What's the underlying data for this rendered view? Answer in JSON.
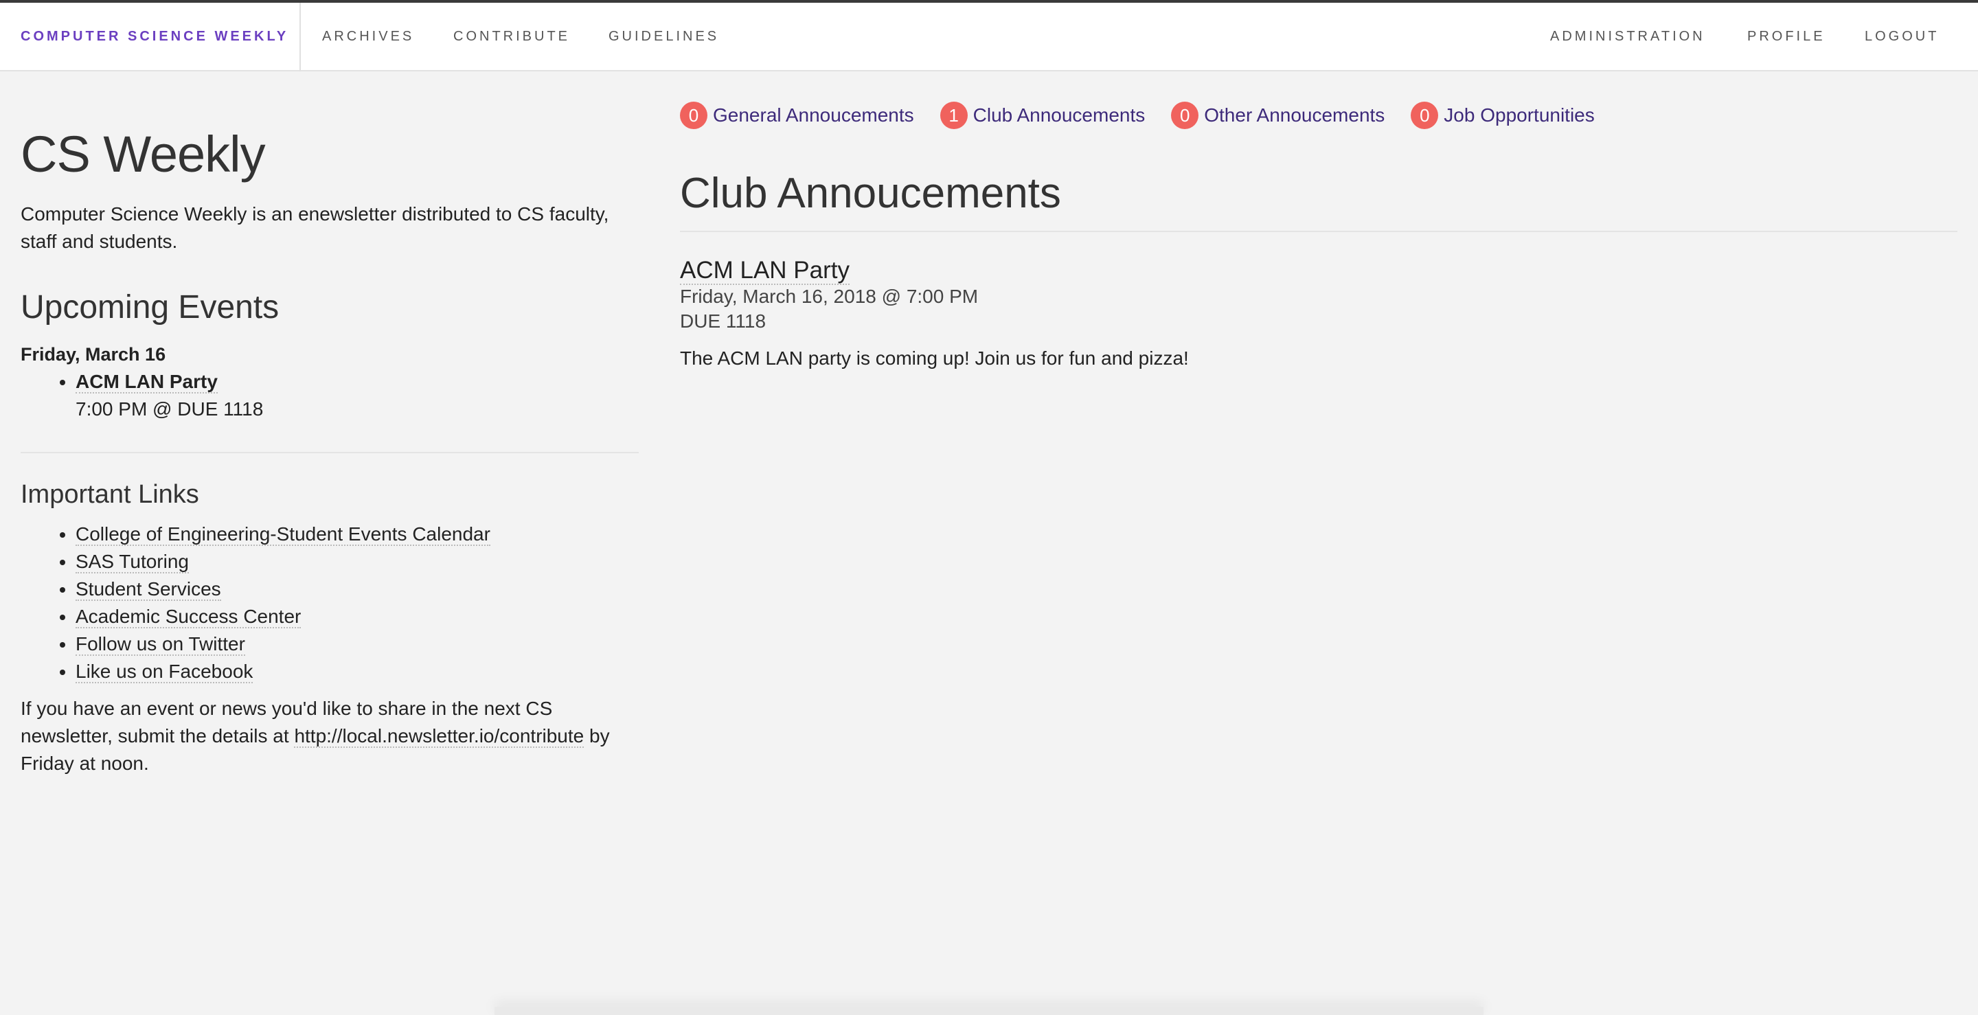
{
  "header": {
    "brand": "COMPUTER SCIENCE WEEKLY",
    "nav_left": [
      "ARCHIVES",
      "CONTRIBUTE",
      "GUIDELINES"
    ],
    "nav_right": [
      "ADMINISTRATION",
      "PROFILE",
      "LOGOUT"
    ]
  },
  "sidebar": {
    "title": "CS Weekly",
    "intro": "Computer Science Weekly is an enewsletter distributed to CS faculty, staff and students.",
    "upcoming_title": "Upcoming Events",
    "event_day": "Friday, March 16",
    "events": [
      {
        "title": "ACM LAN Party",
        "detail": "7:00 PM @ DUE 1118"
      }
    ],
    "links_title": "Important Links",
    "links": [
      "College of Engineering-Student Events Calendar",
      "SAS Tutoring",
      "Student Services",
      "Academic Success Center",
      "Follow us on Twitter",
      "Like us on Facebook"
    ],
    "contribute_before": "If you have an event or news you'd like to share in the next CS newsletter, submit the details at ",
    "contribute_link": "http://local.newsletter.io/contribute",
    "contribute_after": " by Friday at noon."
  },
  "main": {
    "tabs": [
      {
        "count": "0",
        "label": "General Annoucements"
      },
      {
        "count": "1",
        "label": "Club Annoucements"
      },
      {
        "count": "0",
        "label": "Other Annoucements"
      },
      {
        "count": "0",
        "label": "Job Opportunities"
      }
    ],
    "section_title": "Club Annoucements",
    "post": {
      "title": "ACM LAN Party",
      "datetime": "Friday, March 16, 2018 @ 7:00 PM",
      "location": "DUE 1118",
      "body": "The ACM LAN party is coming up! Join us for fun and pizza!"
    }
  },
  "colors": {
    "brand": "#6b3fc0",
    "badge": "#f0625d",
    "tab_link": "#3d2a7a",
    "background": "#f3f3f3"
  }
}
